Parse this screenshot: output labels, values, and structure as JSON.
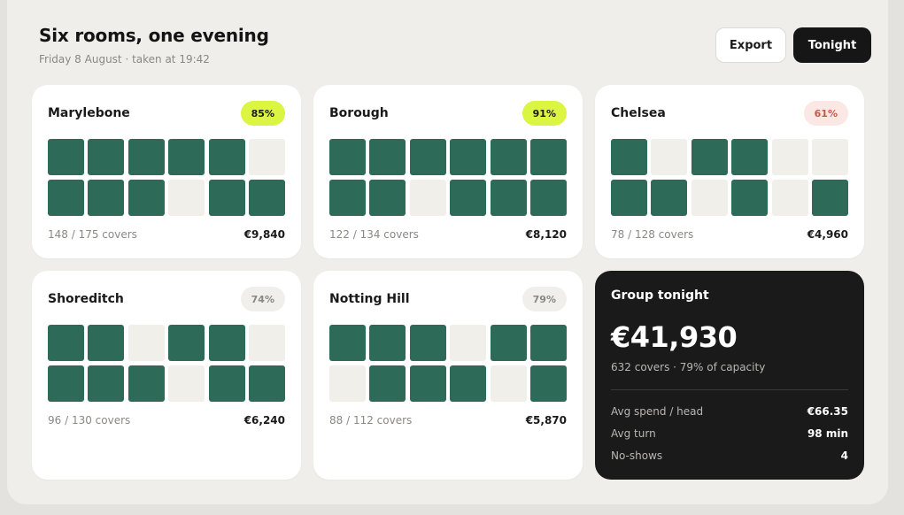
{
  "header": {
    "title": "Six rooms, one evening",
    "subtitle": "Friday 8 August · taken at 19:42",
    "export_label": "Export",
    "tonight_label": "Tonight"
  },
  "colors": {
    "table_occupied": "#2d6b58",
    "table_empty": "#f1efea",
    "pill_high": "#dcf542",
    "pill_low": "#fbe7e3",
    "summary_bg": "#1a1a1a"
  },
  "rooms": [
    {
      "name": "Marylebone",
      "occupancy": "85%",
      "status": "high",
      "covers": "148 / 175 covers",
      "revenue": "€9,840",
      "tables": [
        1,
        1,
        1,
        1,
        1,
        0,
        1,
        1,
        1,
        0,
        1,
        1
      ]
    },
    {
      "name": "Borough",
      "occupancy": "91%",
      "status": "high",
      "covers": "122 / 134 covers",
      "revenue": "€8,120",
      "tables": [
        1,
        1,
        1,
        1,
        1,
        1,
        1,
        1,
        0,
        1,
        1,
        1
      ]
    },
    {
      "name": "Chelsea",
      "occupancy": "61%",
      "status": "low",
      "covers": "78 / 128 covers",
      "revenue": "€4,960",
      "tables": [
        1,
        0,
        1,
        1,
        0,
        0,
        1,
        1,
        0,
        1,
        0,
        1
      ]
    },
    {
      "name": "Shoreditch",
      "occupancy": "74%",
      "status": "mid",
      "covers": "96 / 130 covers",
      "revenue": "€6,240",
      "tables": [
        1,
        1,
        0,
        1,
        1,
        0,
        1,
        1,
        1,
        0,
        1,
        1
      ]
    },
    {
      "name": "Notting Hill",
      "occupancy": "79%",
      "status": "mid",
      "covers": "88 / 112 covers",
      "revenue": "€5,870",
      "tables": [
        1,
        1,
        1,
        0,
        1,
        1,
        0,
        1,
        1,
        1,
        0,
        1
      ]
    }
  ],
  "summary": {
    "title": "Group tonight",
    "total": "€41,930",
    "subtitle": "632 covers · 79% of capacity",
    "stats": [
      {
        "label": "Avg spend / head",
        "value": "€66.35"
      },
      {
        "label": "Avg turn",
        "value": "98 min"
      },
      {
        "label": "No-shows",
        "value": "4"
      }
    ]
  }
}
